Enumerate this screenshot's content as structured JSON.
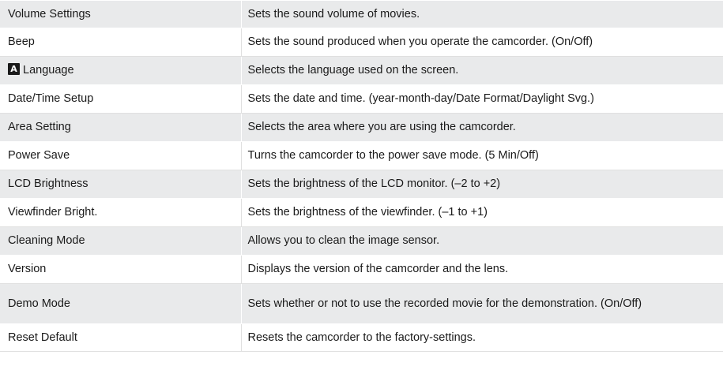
{
  "settings": [
    {
      "name": "Volume Settings",
      "description": "Sets the sound volume of movies."
    },
    {
      "name": "Beep",
      "description": "Sets the sound produced when you operate the camcorder. (On/Off)"
    },
    {
      "name": "Language",
      "icon": "language-a-icon",
      "description": "Selects the language used on the screen."
    },
    {
      "name": "Date/Time Setup",
      "description": "Sets the date and time. (year-month-day/Date Format/Daylight Svg.)"
    },
    {
      "name": "Area Setting",
      "description": "Selects the area where you are using the camcorder."
    },
    {
      "name": "Power Save",
      "description": "Turns the camcorder to the power save mode. (5 Min/Off)"
    },
    {
      "name": "LCD Brightness",
      "description": "Sets the brightness of the LCD monitor. (–2 to +2)"
    },
    {
      "name": "Viewfinder Bright.",
      "description": "Sets the brightness of the viewfinder. (–1 to +1)"
    },
    {
      "name": "Cleaning Mode",
      "description": "Allows you to clean the image sensor."
    },
    {
      "name": "Version",
      "description": "Displays the version of the camcorder and the lens."
    },
    {
      "name": "Demo Mode",
      "description": "Sets whether or not to use the recorded movie for the demonstration. (On/Off)"
    },
    {
      "name": "Reset Default",
      "description": "Resets the camcorder to the factory-settings."
    }
  ],
  "colors": {
    "row_shaded": "#e9eaeb",
    "row_plain": "#ffffff",
    "text": "#1a1a1a"
  }
}
